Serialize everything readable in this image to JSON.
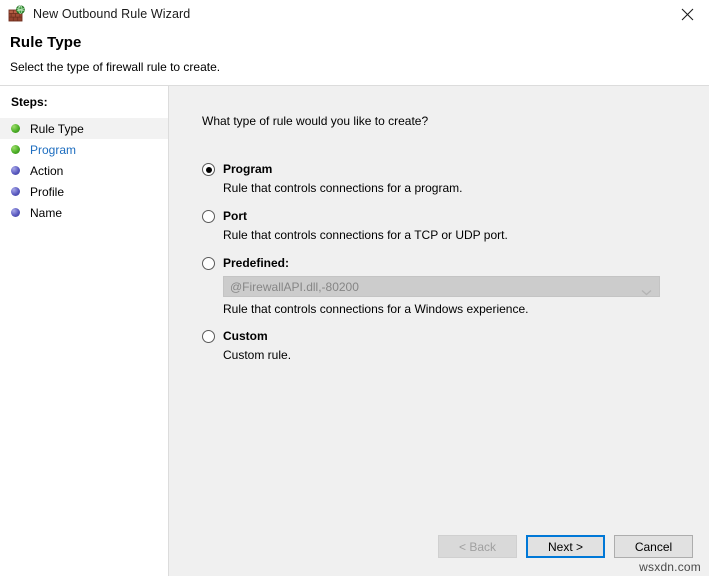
{
  "window": {
    "title": "New Outbound Rule Wizard",
    "icon": "firewall-globe-icon",
    "close_label": "×"
  },
  "header": {
    "title": "Rule Type",
    "subtitle": "Select the type of firewall rule to create."
  },
  "sidebar": {
    "heading": "Steps:",
    "items": [
      {
        "label": "Rule Type",
        "state": "done",
        "current": true
      },
      {
        "label": "Program",
        "state": "done",
        "current": false
      },
      {
        "label": "Action",
        "state": "pending",
        "current": false
      },
      {
        "label": "Profile",
        "state": "pending",
        "current": false
      },
      {
        "label": "Name",
        "state": "pending",
        "current": false
      }
    ]
  },
  "main": {
    "question": "What type of rule would you like to create?",
    "options": [
      {
        "label": "Program",
        "description": "Rule that controls connections for a program.",
        "selected": true
      },
      {
        "label": "Port",
        "description": "Rule that controls connections for a TCP or UDP port.",
        "selected": false
      },
      {
        "label": "Predefined:",
        "description": "Rule that controls connections for a Windows experience.",
        "selected": false,
        "combo": {
          "value": "@FirewallAPI.dll,-80200",
          "enabled": false,
          "arrow": "chevron-down-icon"
        }
      },
      {
        "label": "Custom",
        "description": "Custom rule.",
        "selected": false
      }
    ]
  },
  "footer": {
    "back_label": "< Back",
    "next_label": "Next >",
    "cancel_label": "Cancel"
  },
  "watermark": {
    "text": "wsxdn.com"
  },
  "colors": {
    "accent": "#0078d7",
    "step_link": "#1d6dbf",
    "step_done": "#4caf27",
    "step_pending": "#5a5ac0",
    "content_bg": "#f0f0f0",
    "combo_disabled_bg": "#cccccc"
  }
}
